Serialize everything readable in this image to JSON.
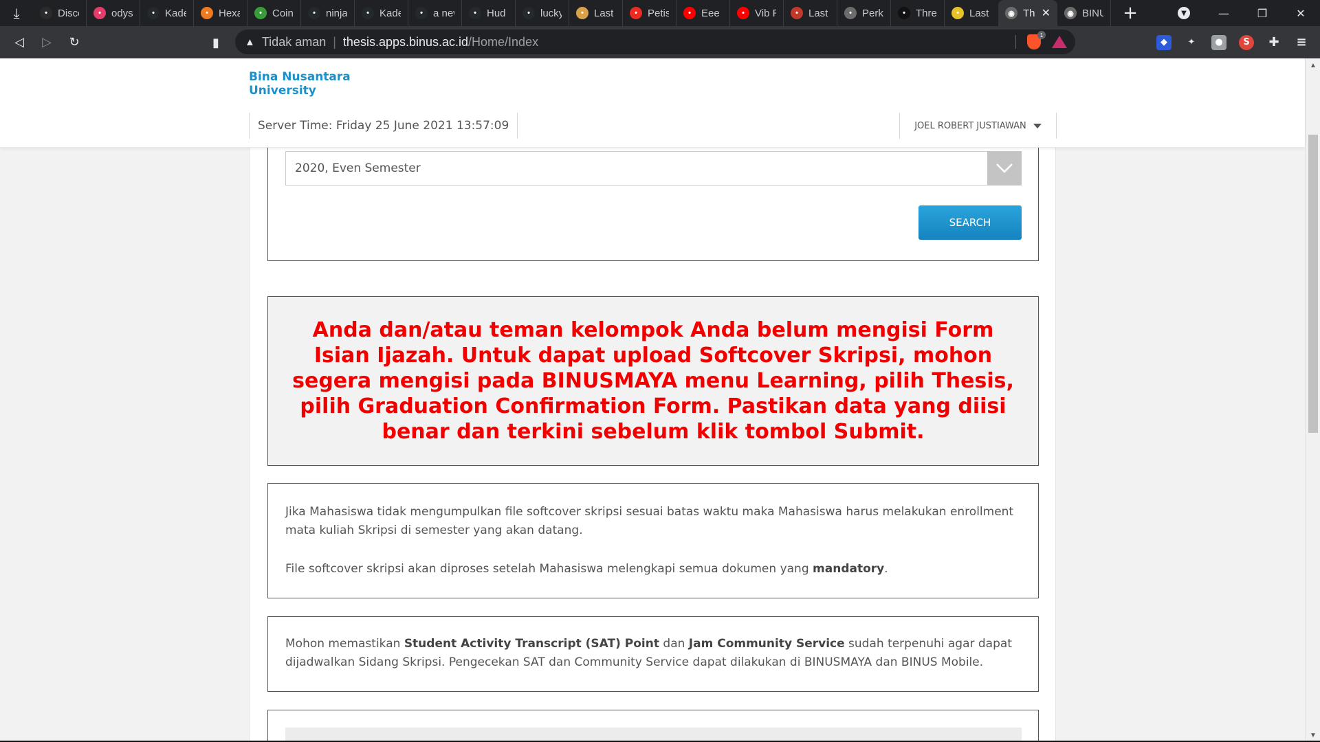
{
  "browser": {
    "tabs": [
      {
        "title": "Disco",
        "icon": "epic-games-icon",
        "color": "#2b2b2b"
      },
      {
        "title": "odyse",
        "icon": "odysee-icon",
        "color": "#e43d6b"
      },
      {
        "title": "Kade",
        "icon": "github-icon",
        "color": "#24292e"
      },
      {
        "title": "Hexag",
        "icon": "hexagon-icon",
        "color": "#f07a20"
      },
      {
        "title": "CoinT",
        "icon": "tree-icon",
        "color": "#3a9b3a"
      },
      {
        "title": "ninjan",
        "icon": "github-icon",
        "color": "#24292e"
      },
      {
        "title": "KadeI",
        "icon": "github-icon",
        "color": "#24292e"
      },
      {
        "title": "a new",
        "icon": "github-icon",
        "color": "#24292e"
      },
      {
        "title": "Hud &",
        "icon": "github-icon",
        "color": "#24292e"
      },
      {
        "title": "lucky",
        "icon": "github-icon",
        "color": "#24292e"
      },
      {
        "title": "Last F",
        "icon": "game-icon",
        "color": "#d9a24a"
      },
      {
        "title": "Petisi",
        "icon": "change-org-icon",
        "color": "#ec2c22"
      },
      {
        "title": "Eee -",
        "icon": "youtube-icon",
        "color": "#ff0000"
      },
      {
        "title": "Vib R",
        "icon": "youtube-icon",
        "color": "#ff0000"
      },
      {
        "title": "Last F",
        "icon": "game-icon",
        "color": "#c0392b"
      },
      {
        "title": "Perke",
        "icon": "bolt-icon",
        "color": "#6c6c6c"
      },
      {
        "title": "Three",
        "icon": "triangle-icon",
        "color": "#111111"
      },
      {
        "title": "Last F",
        "icon": "banana-icon",
        "color": "#e6c229"
      }
    ],
    "active_tab": {
      "title": "Th",
      "icon": "eye-icon"
    },
    "next_tab": {
      "title": "BINU",
      "icon": "eye-icon"
    },
    "address": {
      "warning": "Tidak aman",
      "host": "thesis.apps.binus.ac.id",
      "path": "/Home/Index"
    },
    "brave_badge": "1"
  },
  "site": {
    "logo_line1": "Bina Nusantara",
    "logo_line2": "University",
    "server_time": "Server Time: Friday 25 June 2021 13:57:09",
    "user_name": "JOEL ROBERT JUSTIAWAN"
  },
  "search": {
    "semester_selected": "2020, Even Semester",
    "search_label": "SEARCH"
  },
  "alert": {
    "text": "Anda dan/atau teman kelompok Anda belum mengisi Form Isian Ijazah. Untuk dapat upload Softcover Skripsi, mohon segera mengisi pada BINUSMAYA menu Learning, pilih Thesis, pilih Graduation Confirmation Form. Pastikan data yang diisi benar dan terkini sebelum klik tombol Submit."
  },
  "info": {
    "para1": "Jika Mahasiswa tidak mengumpulkan file softcover skripsi sesuai batas waktu maka Mahasiswa harus melakukan enrollment mata kuliah Skripsi di semester yang akan datang.",
    "para2_before": "File softcover skripsi akan diproses setelah Mahasiswa melengkapi semua dokumen yang ",
    "para2_bold": "mandatory",
    "para2_after": "."
  },
  "sat": {
    "t1": "Mohon memastikan ",
    "b1": "Student Activity Transcript (SAT) Point",
    "t2": " dan ",
    "b2": "Jam Community Service",
    "t3": " sudah terpenuhi agar dapat dijadwalkan Sidang Skripsi. Pengecekan SAT dan Community Service dapat dilakukan di BINUSMAYA dan BINUS Mobile."
  },
  "colors": {
    "brand_blue": "#1e90c8",
    "alert_red": "#f20000",
    "button_blue": "#1a8fcd"
  }
}
